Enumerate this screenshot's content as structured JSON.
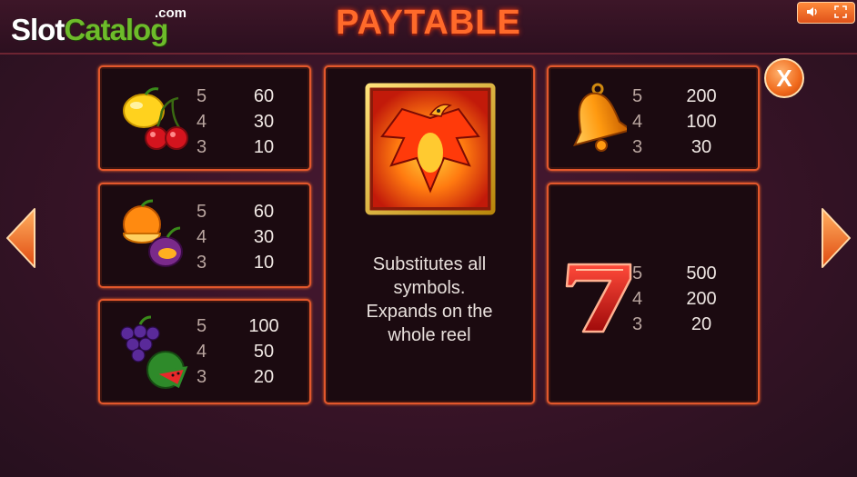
{
  "header": {
    "logo_slot": "Slot",
    "logo_catalog": "Catalog",
    "logo_com": ".com",
    "title": "PAYTABLE"
  },
  "controls": {
    "close_label": "X",
    "sound_icon": "speaker-icon",
    "fullscreen_icon": "fullscreen-icon"
  },
  "symbols": {
    "lemon_cherry": {
      "rows": [
        {
          "count": "5",
          "pay": "60"
        },
        {
          "count": "4",
          "pay": "30"
        },
        {
          "count": "3",
          "pay": "10"
        }
      ]
    },
    "orange_plum": {
      "rows": [
        {
          "count": "5",
          "pay": "60"
        },
        {
          "count": "4",
          "pay": "30"
        },
        {
          "count": "3",
          "pay": "10"
        }
      ]
    },
    "grape_watermelon": {
      "rows": [
        {
          "count": "5",
          "pay": "100"
        },
        {
          "count": "4",
          "pay": "50"
        },
        {
          "count": "3",
          "pay": "20"
        }
      ]
    },
    "bell": {
      "rows": [
        {
          "count": "5",
          "pay": "200"
        },
        {
          "count": "4",
          "pay": "100"
        },
        {
          "count": "3",
          "pay": "30"
        }
      ]
    },
    "seven": {
      "rows": [
        {
          "count": "5",
          "pay": "500"
        },
        {
          "count": "4",
          "pay": "200"
        },
        {
          "count": "3",
          "pay": "20"
        }
      ]
    }
  },
  "wild": {
    "line1": "Substitutes all",
    "line2": "symbols.",
    "line3": "Expands on the",
    "line4": "whole reel"
  },
  "colors": {
    "accent": "#ff6a2a",
    "panel_border": "#e2572c",
    "panel_bg": "#1b0a10"
  }
}
